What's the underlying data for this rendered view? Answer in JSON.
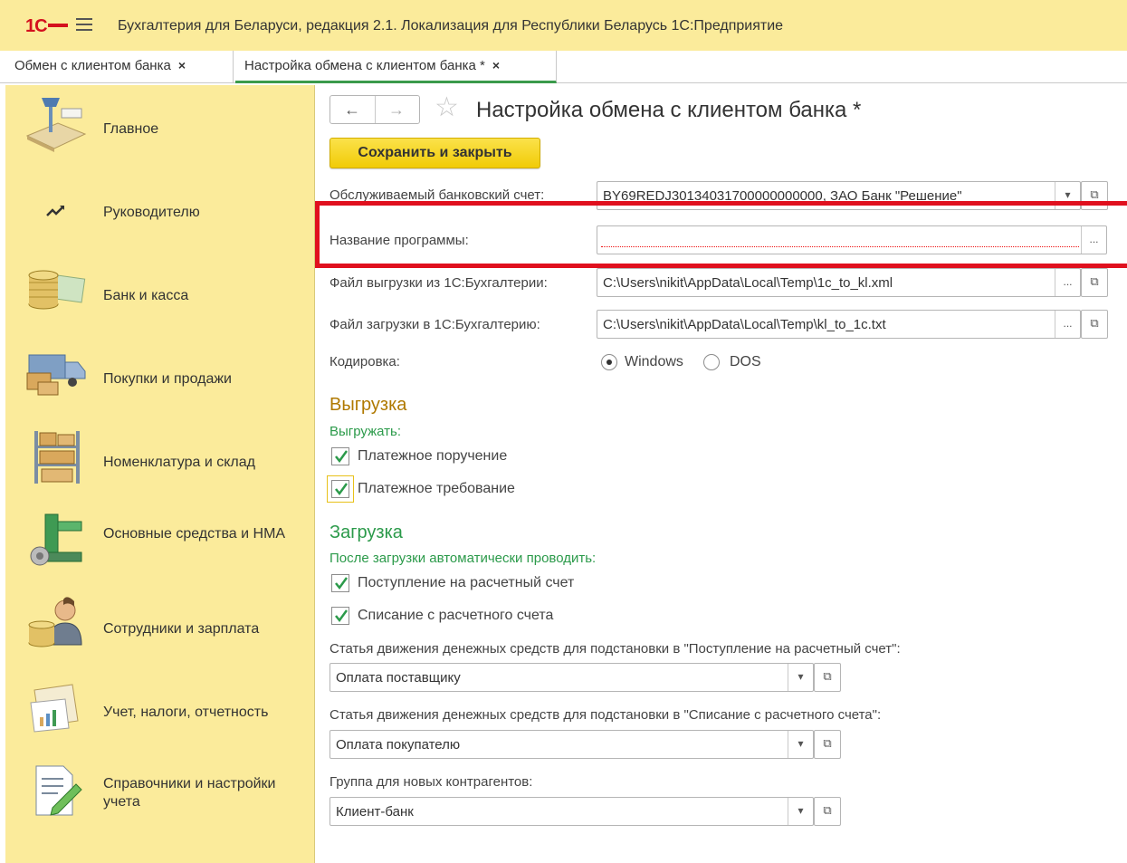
{
  "app": {
    "logo": "1С",
    "title": "Бухгалтерия для Беларуси, редакция 2.1. Локализация для Республики Беларусь  1С:Предприятие"
  },
  "tabs": [
    {
      "label": "Обмен с клиентом банка",
      "close": "×"
    },
    {
      "label": "Настройка обмена с клиентом банка *",
      "close": "×"
    }
  ],
  "sidebar": {
    "items": [
      {
        "label": "Главное",
        "icon": "desk-lamp-icon"
      },
      {
        "label": "Руководителю",
        "icon": "trend-chart-icon"
      },
      {
        "label": "Банк и касса",
        "icon": "coins-banknotes-icon"
      },
      {
        "label": "Покупки и продажи",
        "icon": "delivery-truck-icon"
      },
      {
        "label": "Номенклатура и склад",
        "icon": "warehouse-shelf-icon"
      },
      {
        "label": "Основные средства и НМА",
        "icon": "machine-tool-icon"
      },
      {
        "label": "Сотрудники и зарплата",
        "icon": "employee-coins-icon"
      },
      {
        "label": "Учет, налоги, отчетность",
        "icon": "reports-chart-icon"
      },
      {
        "label": "Справочники и настройки учета",
        "icon": "document-pencil-icon"
      }
    ]
  },
  "form": {
    "title": "Настройка обмена с клиентом банка *",
    "back": "←",
    "forward": "→",
    "save_button": "Сохранить и закрыть",
    "bank_account_label": "Обслуживаемый банковский счет:",
    "bank_account_value": "BY69REDJ30134031700000000000, ЗАО Банк \"Решение\"",
    "program_name_label": "Название программы:",
    "program_name_value": "",
    "export_file_label": "Файл выгрузки из 1С:Бухгалтерии:",
    "export_file_value": "C:\\Users\\nikit\\AppData\\Local\\Temp\\1c_to_kl.xml",
    "import_file_label": "Файл загрузки в 1С:Бухгалтерию:",
    "import_file_value": "C:\\Users\\nikit\\AppData\\Local\\Temp\\kl_to_1c.txt",
    "encoding_label": "Кодировка:",
    "encoding_options": [
      "Windows",
      "DOS"
    ],
    "encoding_selected": "Windows",
    "export_section": "Выгрузка",
    "export_sub": "Выгружать:",
    "export_payment_order": "Платежное поручение",
    "export_payment_request": "Платежное требование",
    "import_section": "Загрузка",
    "import_sub": "После загрузки автоматически проводить:",
    "import_receipt": "Поступление на расчетный счет",
    "import_writeoff": "Списание с расчетного счета",
    "cash_flow_receipt_label": "Статья движения денежных средств для подстановки в \"Поступление на расчетный счет\":",
    "cash_flow_receipt_value": "Оплата поставщику",
    "cash_flow_writeoff_label": "Статья движения денежных средств для подстановки в \"Списание с расчетного счета\":",
    "cash_flow_writeoff_value": "Оплата покупателю",
    "counterparty_group_label": "Группа для новых контрагентов:",
    "counterparty_group_value": "Клиент-банк",
    "dots": "...",
    "dropdown": "▾",
    "open": "⧉"
  },
  "colors": {
    "titlebar": "#fbeb9b",
    "accent_red": "#e0101e",
    "section_orange": "#b07900",
    "section_green": "#2b9a4a",
    "save_yellow": "#f1cb07"
  }
}
